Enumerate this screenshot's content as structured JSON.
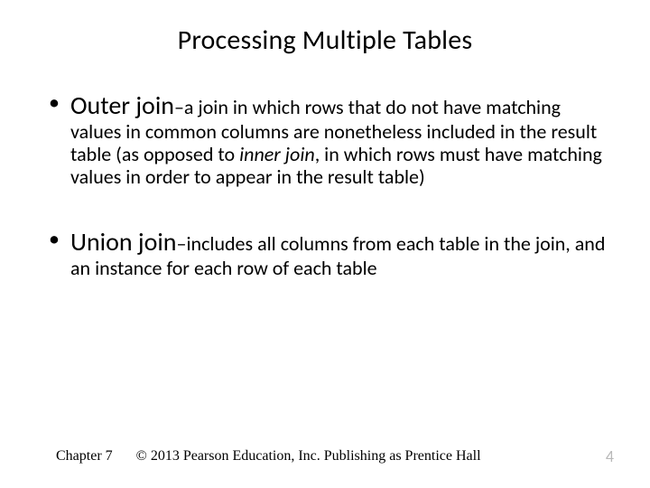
{
  "title": "Processing Multiple Tables",
  "bullets": [
    {
      "term": "Outer join",
      "dash": "–",
      "def_before_italic": "a join in which rows that do not have matching values in common columns are nonetheless included in the result table (as opposed to ",
      "italic": "inner join",
      "def_after_italic": ", in which rows must have matching values in order to appear in the result table)"
    },
    {
      "term": "Union join",
      "dash": "–",
      "def_before_italic": "includes all columns from each table in the join, and an instance for each row of each table",
      "italic": "",
      "def_after_italic": ""
    }
  ],
  "footer": {
    "chapter": "Chapter 7",
    "copyright": "© 2013 Pearson Education, Inc.  Publishing as Prentice Hall",
    "page": "4"
  }
}
